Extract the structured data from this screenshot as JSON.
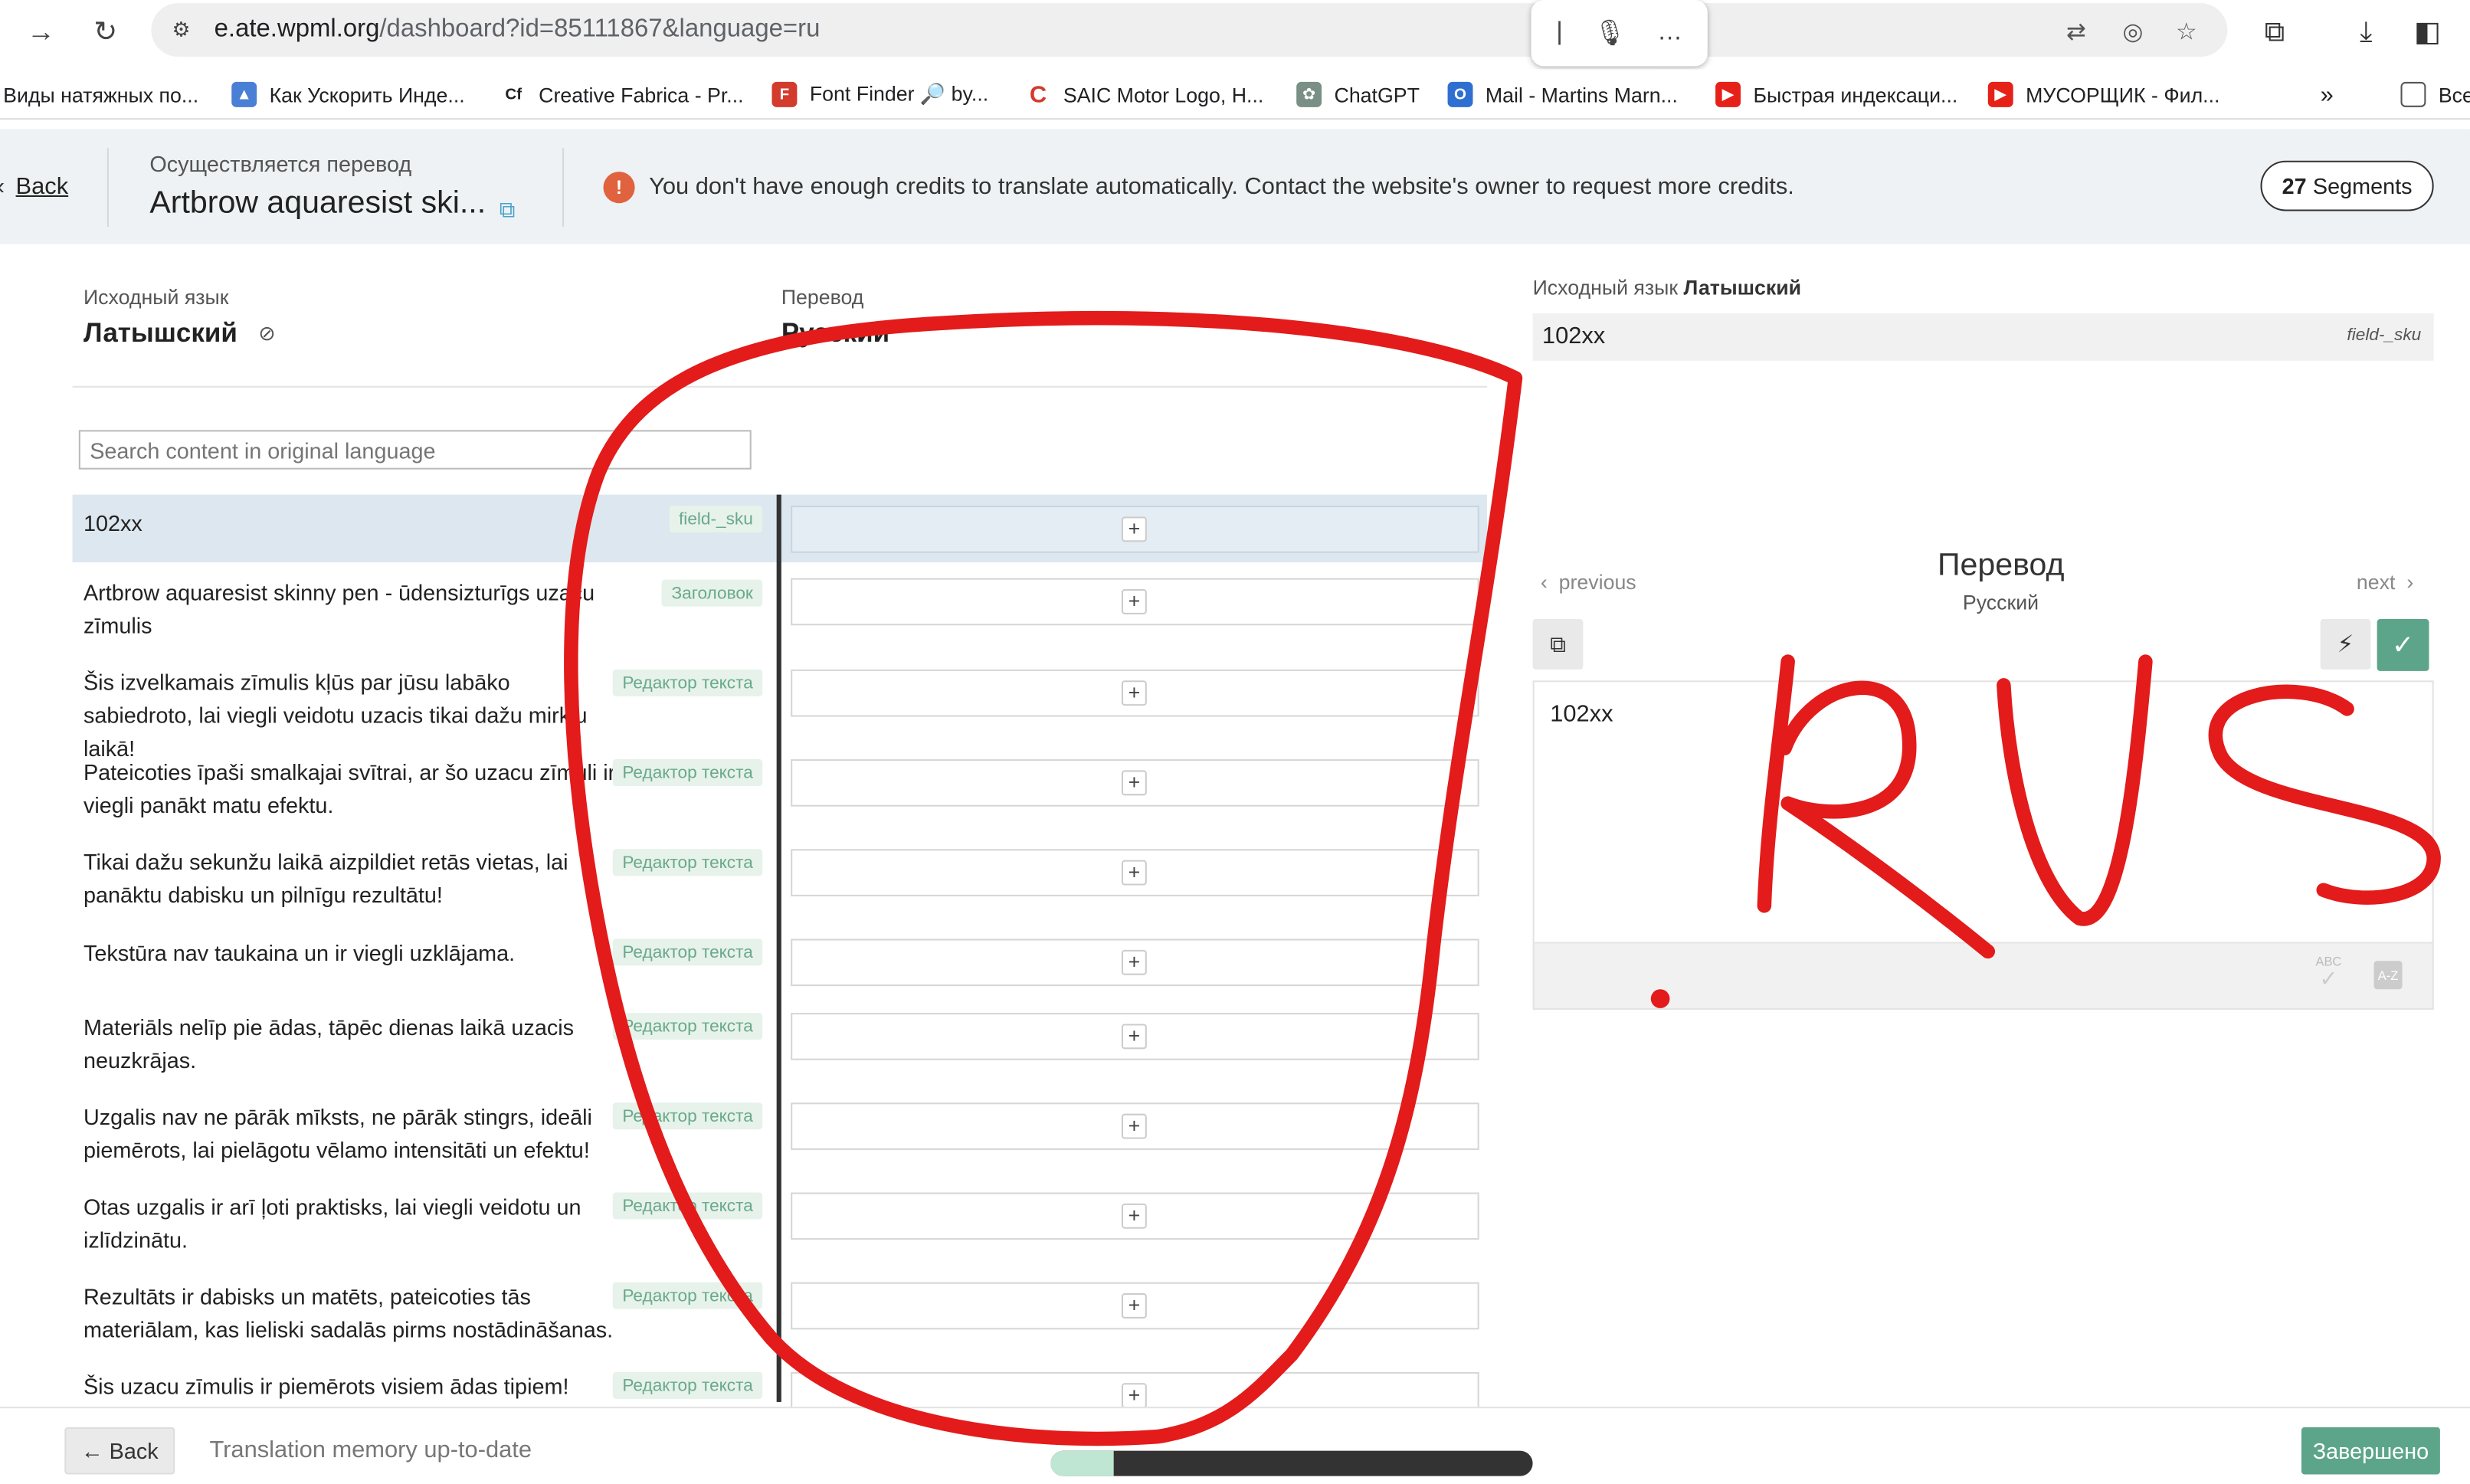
{
  "browser": {
    "url_host": "e.ate.wpml.org",
    "url_path": "/dashboard?id=85111867&language=ru",
    "bookmarks": [
      {
        "label": "Виды натяжных по...",
        "color": "#ffffff"
      },
      {
        "label": "Как Ускорить Инде...",
        "color": "#4a7fd6"
      },
      {
        "label": "Creative Fabrica - Pr...",
        "color": "#222222"
      },
      {
        "label": "Font Finder 🔎 by...",
        "color": "#d33b2c"
      },
      {
        "label": "SAIC Motor Logo, H...",
        "color": "#d33b2c"
      },
      {
        "label": "ChatGPT",
        "color": "#7a8f86"
      },
      {
        "label": "Mail - Martins Marn...",
        "color": "#2f6fd1"
      },
      {
        "label": "Быстрая индексаци...",
        "color": "#e62117"
      },
      {
        "label": "МУСОРЩИК - Фил...",
        "color": "#e62117"
      },
      {
        "label": "Все",
        "color": "#555555"
      }
    ]
  },
  "header": {
    "back": "Back",
    "caption": "Осуществляется перевод",
    "title": "Artbrow aquaresist ski...",
    "warning": "You don't have enough credits to translate automatically. Contact the website's owner to request more credits.",
    "segments_count": "27",
    "segments_label": "Segments"
  },
  "editor": {
    "source_caption": "Исходный язык",
    "source_lang": "Латышский",
    "target_caption": "Перевод",
    "target_lang": "Русский",
    "search_placeholder": "Search content in original language",
    "rows": [
      {
        "text": "102xx",
        "tag": "field-_sku"
      },
      {
        "text": "Artbrow aquaresist skinny pen - ūdensizturīgs uzacu zīmulis",
        "tag": "Заголовок"
      },
      {
        "text": "Šis izvelkamais zīmulis kļūs par jūsu labāko sabiedroto, lai viegli veidotu uzacis tikai dažu mirkļu laikā!",
        "tag": "Редактор текста"
      },
      {
        "text": "Pateicoties īpaši smalkajai svītrai, ar šo uzacu zīmuli ir viegli panākt matu efektu.",
        "tag": "Редактор текста"
      },
      {
        "text": "Tikai dažu sekunžu laikā aizpildiet retās vietas, lai panāktu dabisku un pilnīgu rezultātu!",
        "tag": "Редактор текста"
      },
      {
        "text": "Tekstūra nav taukaina un ir viegli uzklājama.",
        "tag": "Редактор текста"
      },
      {
        "text": "Materiāls nelīp pie ādas, tāpēc dienas laikā uzacis neuzkrājas.",
        "tag": "Редактор текста"
      },
      {
        "text": "Uzgalis nav ne pārāk mīksts, ne pārāk stingrs, ideāli piemērots, lai pielāgotu vēlamo intensitāti un efektu!",
        "tag": "Редактор текста"
      },
      {
        "text": "Otas uzgalis ir arī ļoti praktisks, lai viegli veidotu un izlīdzinātu.",
        "tag": "Редактор текста"
      },
      {
        "text": "Rezultāts ir dabisks un matēts, pateicoties tās materiālam, kas lieliski sadalās pirms nostādināšanas.",
        "tag": "Редактор текста"
      },
      {
        "text": "Šis uzacu zīmulis ir piemērots visiem ādas tipiem!",
        "tag": "Редактор текста"
      }
    ]
  },
  "panel": {
    "source_caption": "Исходный язык",
    "source_lang": "Латышский",
    "source_value": "102xx",
    "field": "field-_sku",
    "previous": "previous",
    "next": "next",
    "title": "Перевод",
    "lang": "Русский",
    "translation_value": "102xx"
  },
  "footer": {
    "back": "← Back",
    "status": "Translation memory up-to-date",
    "progress": 0.13,
    "done": "Завершено"
  },
  "annotation": {
    "text": "RUS",
    "color": "#e31b1b"
  }
}
